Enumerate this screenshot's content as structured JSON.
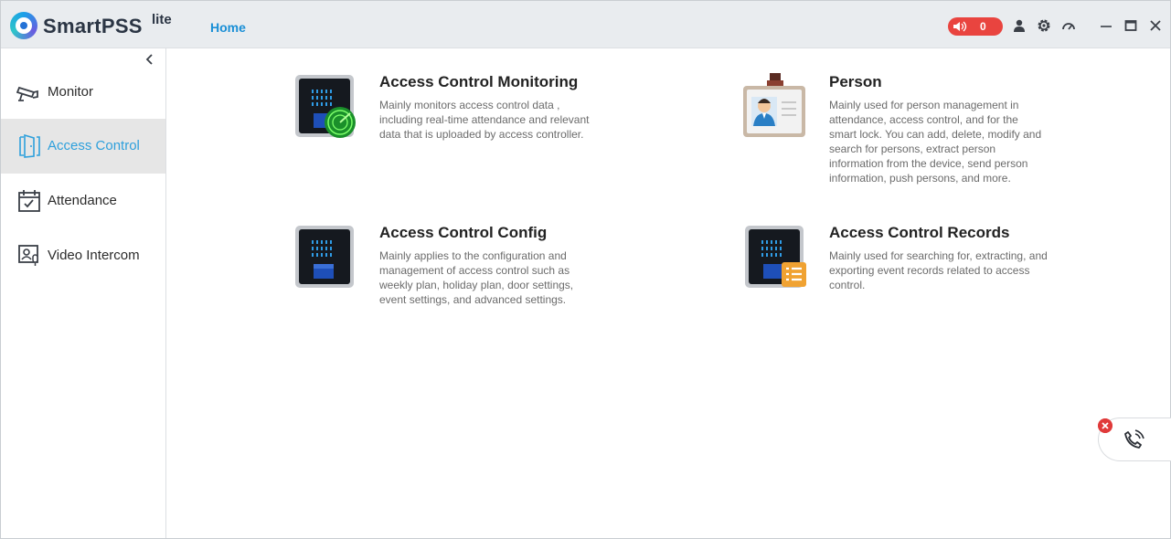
{
  "window": {
    "app_name": "SmartPSS",
    "app_suffix": "lite",
    "active_tab": "Home",
    "alarm_count": "0",
    "colors": {
      "accent": "#1a8fd6",
      "alarm": "#e9443f",
      "active_nav_bg": "#e6e6e6"
    }
  },
  "toolbar_icons": [
    "speaker-icon",
    "user-icon",
    "gear-icon",
    "speedometer-icon",
    "minimize-icon",
    "maximize-icon",
    "close-icon"
  ],
  "sidebar": {
    "items": [
      {
        "label": "Monitor",
        "icon": "camera-icon",
        "active": false
      },
      {
        "label": "Access Control",
        "icon": "door-icon",
        "active": true
      },
      {
        "label": "Attendance",
        "icon": "calendar-check-icon",
        "active": false
      },
      {
        "label": "Video Intercom",
        "icon": "intercom-icon",
        "active": false
      }
    ]
  },
  "cards": [
    {
      "title": "Access Control Monitoring",
      "icon": "access-device-radar-icon",
      "description": "Mainly monitors access control data , including real-time attendance and relevant data that is uploaded by access controller."
    },
    {
      "title": "Person",
      "icon": "id-badge-icon",
      "description": "Mainly used for person management in attendance, access control, and for the smart lock. You can add, delete, modify and search for persons, extract person information from the device, send person information, push persons, and more."
    },
    {
      "title": "Access Control Config",
      "icon": "access-device-icon",
      "description": "Mainly applies to the configuration and management of access control such as weekly plan, holiday plan, door settings, event settings, and advanced settings."
    },
    {
      "title": "Access Control Records",
      "icon": "access-device-records-icon",
      "description": "Mainly used for searching for, extracting, and exporting event records related to access control."
    }
  ]
}
